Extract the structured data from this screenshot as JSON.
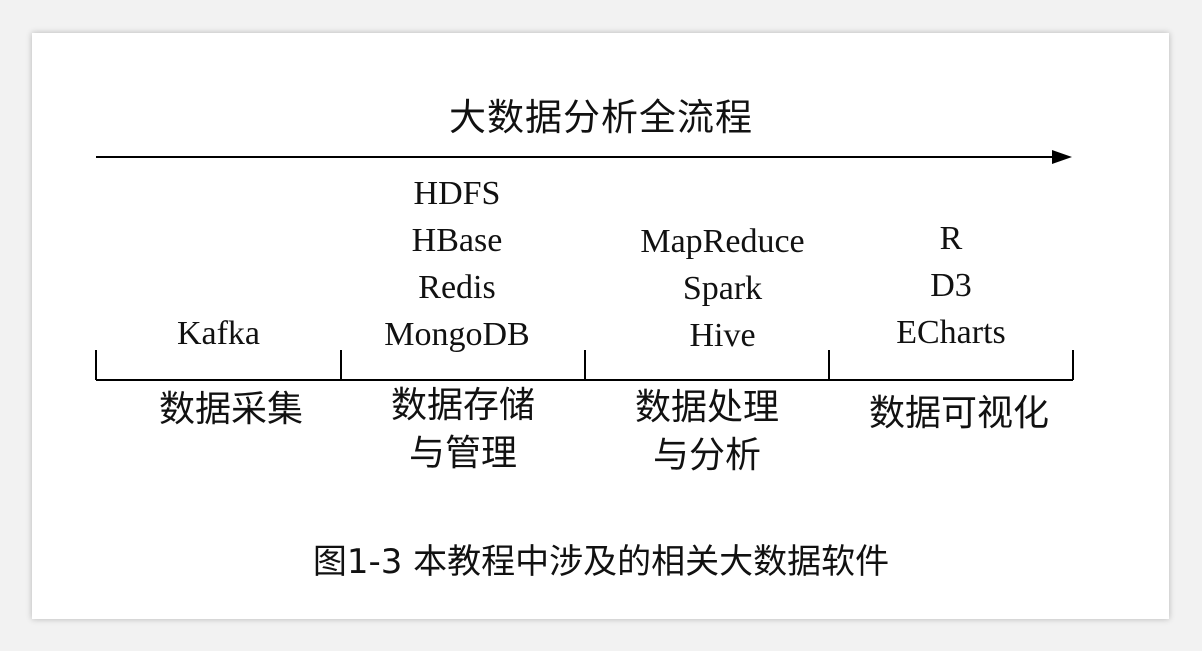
{
  "title": "大数据分析全流程",
  "stages": [
    {
      "label": "数据采集",
      "tools": [
        "Kafka"
      ]
    },
    {
      "label": "数据存储\n与管理",
      "tools": [
        "HDFS",
        "HBase",
        "Redis",
        "MongoDB"
      ]
    },
    {
      "label": "数据处理\n与分析",
      "tools": [
        "MapReduce",
        "Spark",
        "Hive"
      ]
    },
    {
      "label": "数据可视化",
      "tools": [
        "R",
        "D3",
        "ECharts"
      ]
    }
  ],
  "caption": "图1-3 本教程中涉及的相关大数据软件"
}
